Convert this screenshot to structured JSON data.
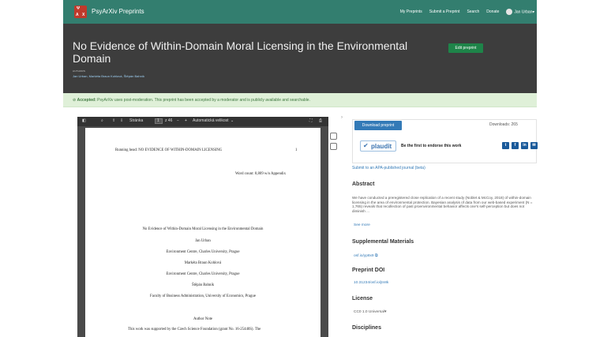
{
  "nav": {
    "brand": "PsyArXiv Preprints",
    "logo_letters": [
      "Ψ",
      "A",
      "X"
    ],
    "links": [
      "My Preprints",
      "Submit a Preprint",
      "Search",
      "Donate"
    ],
    "user": "Jan Urban",
    "user_caret": "▾"
  },
  "header": {
    "title": "No Evidence of Within-Domain Moral Licensing in the Environmental Domain",
    "edit_label": "Edit preprint",
    "authors_label": "AUTHORS",
    "authors": "Jan Urban, Markéta Braun Kohlová, Štěpán Bahník"
  },
  "banner": {
    "bold": "Accepted:",
    "text": "PsyArXiv uses post-moderation. This preprint has been accepted by a moderator and is publicly available and searchable."
  },
  "pdf_toolbar": {
    "sidebar_icon": "◧",
    "search_icon": "⌕",
    "up": "⇧",
    "down": "⇩",
    "page_label": "Stránka",
    "page_value": "1",
    "of_pages": "z 46",
    "zoom_out": "−",
    "zoom_in": "+",
    "zoom_value": "Automatická velikost",
    "zoom_caret": "⌄",
    "fullscreen": "⛶",
    "print": "⎙"
  },
  "pdf_page": {
    "running_head": "Running head: NO EVIDENCE OF WITHIN-DOMAIN LICENSING",
    "page_number": "1",
    "word_count": "Word count: 8,809 w/o Appendix",
    "title": "No Evidence of Within-Domain Moral Licensing in the Environmental Domain",
    "author1": "Jan Urban",
    "affil1": "Environment Centre, Charles University, Prague",
    "author2": "Markéta Braun Kohlová",
    "affil2": "Environment Centre, Charles University, Prague",
    "author3": "Štěpán Bahník",
    "affil3": "Faculty of Business Administration, University of Economics, Prague",
    "note_head": "Author Note",
    "note_text": "This work was supported by the Czech Science Foundation (grant No. 16-25440S). The"
  },
  "panel": {
    "download_label": "Download preprint",
    "downloads": "Downloads: 265",
    "plaudit_label": "plaudit",
    "plaudit_icon": "✔",
    "endorse_text": "Be the first to endorse this work",
    "social": [
      "t",
      "f",
      "in",
      "✉"
    ],
    "apa_link": "Submit to an APA-published journal (beta)",
    "abstract_heading": "Abstract",
    "abstract_text": "We have conducted a preregistered close replication of a recent study (Noblet & McCoy, 2018) of within-domain licensing in the area of environmental protection. Bayesian analysis of data from our web-based experiment (N = 1,765) reveals that recollection of past proenvironmental behavior affects one's self-perception but does not diminish ...",
    "see_more": "See more",
    "supplemental_heading": "Supplemental Materials",
    "supplemental_link": "osf.io/yp8x9",
    "doi_heading": "Preprint DOI",
    "doi_value": "10.31234/osf.io/jtn8k",
    "license_heading": "License",
    "license_value": "CC0 1.0 Universal",
    "disciplines_heading": "Disciplines"
  },
  "colors": {
    "nav": "#337e6f",
    "header": "#3d3d3d",
    "banner": "#dff0d8",
    "edit": "#1e8449",
    "download": "#337ab7"
  }
}
